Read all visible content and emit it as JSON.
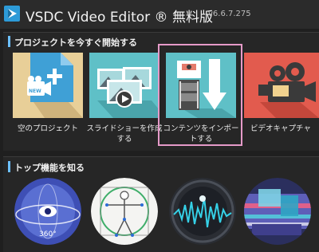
{
  "window": {
    "title_name": "VSDC Video Editor",
    "title_mark": "®",
    "title_edition": "無料版",
    "version": "v6.6.7.275"
  },
  "start_section": {
    "header": "プロジェクトを今すぐ開始する",
    "tiles": [
      {
        "label": "空のプロジェクト",
        "icon": "new-project-icon",
        "badge": "NEW"
      },
      {
        "label": "スライドショーを作成する",
        "icon": "slideshow-icon"
      },
      {
        "label": "コンテンツをインポートする",
        "icon": "import-content-icon",
        "selected": true
      },
      {
        "label": "ビデオキャプチャ",
        "icon": "video-capture-icon"
      }
    ]
  },
  "features_section": {
    "header": "トップ機能を知る",
    "items": [
      {
        "icon": "360-video-icon",
        "badge": "360°"
      },
      {
        "icon": "motion-tracking-icon"
      },
      {
        "icon": "audio-waveform-icon"
      },
      {
        "icon": "video-effects-icon"
      }
    ]
  },
  "colors": {
    "accent_blue": "#6cc0ff",
    "selection_pink": "#e59ac8",
    "background": "#1f1f1f"
  }
}
